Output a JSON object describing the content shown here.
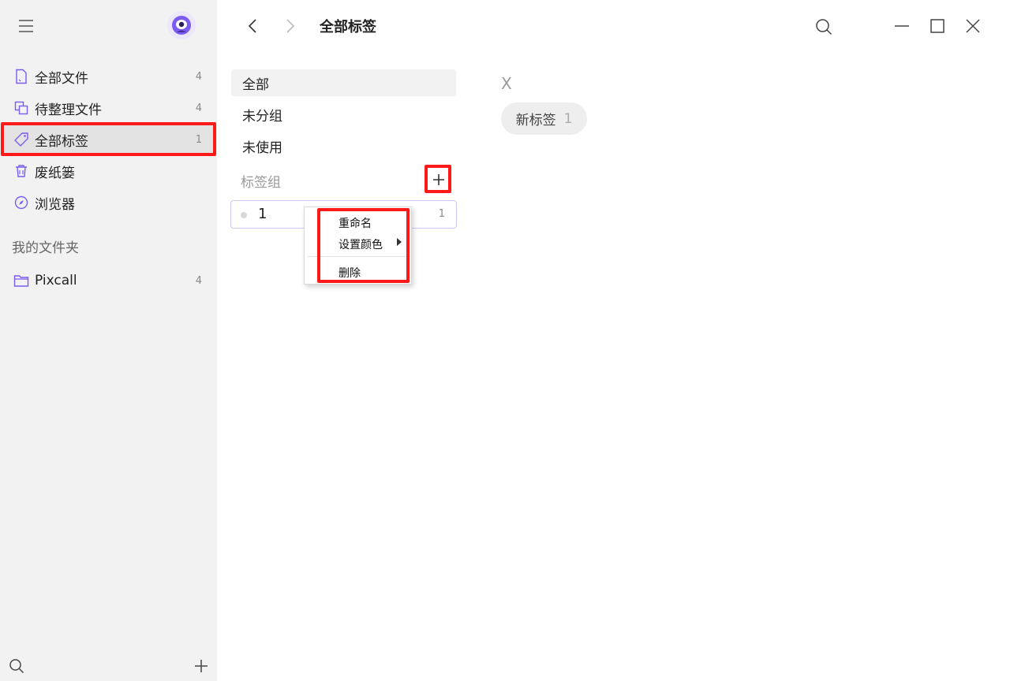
{
  "sidebar": {
    "items": [
      {
        "label": "全部文件",
        "count": "4",
        "icon": "file-icon"
      },
      {
        "label": "待整理文件",
        "count": "4",
        "icon": "copy-files-icon"
      },
      {
        "label": "全部标签",
        "count": "1",
        "icon": "tag-icon"
      },
      {
        "label": "废纸篓",
        "icon": "trash-icon"
      },
      {
        "label": "浏览器",
        "icon": "compass-icon"
      }
    ],
    "folders_title": "我的文件夹",
    "folders": [
      {
        "label": "Pixcall",
        "count": "4",
        "icon": "folder-icon"
      }
    ]
  },
  "header": {
    "title": "全部标签"
  },
  "groups": {
    "items": [
      "全部",
      "未分组",
      "未使用"
    ],
    "tag_groups_title": "标签组",
    "tag_group": {
      "name": "1",
      "count": "1"
    }
  },
  "context_menu": {
    "rename": "重命名",
    "set_color": "设置颜色",
    "delete": "删除"
  },
  "tags_panel": {
    "group_letter": "X",
    "tag": {
      "name": "新标签",
      "count": "1"
    }
  },
  "colors": {
    "accent": "#7b5cf0",
    "highlight": "#ff1a1a",
    "sidebar_bg": "#f2f2f2"
  }
}
